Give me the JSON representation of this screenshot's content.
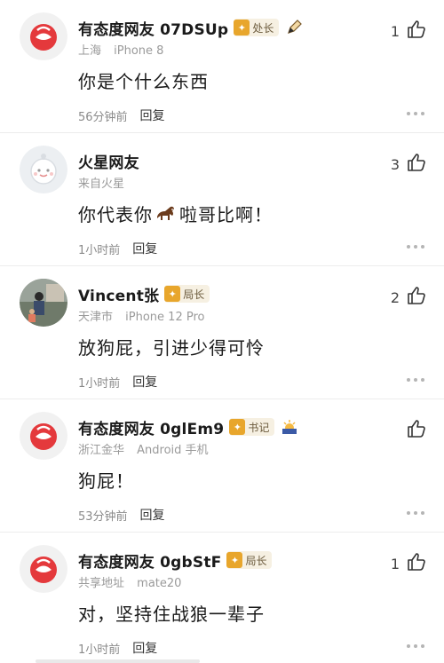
{
  "comments": [
    {
      "avatar": "red-speech-bubble-avatar",
      "username": "有态度网友 07DSUp",
      "badge": {
        "label": "处长",
        "color": "#e8a62c"
      },
      "extra_icon": "pen-icon",
      "location": "上海",
      "device": "iPhone 8",
      "likes": "1",
      "content": "你是个什么东西",
      "time": "56分钟前",
      "reply": "回复"
    },
    {
      "avatar": "mars-robot-avatar",
      "username": "火星网友",
      "location": "来自火星",
      "device": "",
      "likes": "3",
      "content_before": "你代表你",
      "content_emoji": "horse-emoji",
      "content_after": "啦哥比啊！",
      "time": "1小时前",
      "reply": "回复"
    },
    {
      "avatar": "photo-avatar",
      "username": "Vincent张",
      "badge": {
        "label": "局长",
        "color": "#e8a62c"
      },
      "location": "天津市",
      "device": "iPhone 12 Pro",
      "likes": "2",
      "content": "放狗屁，引进少得可怜",
      "time": "1小时前",
      "reply": "回复"
    },
    {
      "avatar": "red-speech-bubble-avatar",
      "username": "有态度网友 0glEm9",
      "badge": {
        "label": "书记",
        "color": "#e8a62c"
      },
      "extra_icon": "sunrise-icon",
      "location": "浙江金华",
      "device": "Android 手机",
      "likes": "",
      "content": "狗屁！",
      "time": "53分钟前",
      "reply": "回复"
    },
    {
      "avatar": "red-speech-bubble-avatar",
      "username": "有态度网友 0gbStF",
      "badge": {
        "label": "局长",
        "color": "#e8a62c"
      },
      "location": "共享地址",
      "device": "mate20",
      "likes": "1",
      "content": "对，坚持住战狼一辈子",
      "time": "1小时前",
      "reply": "回复"
    }
  ]
}
